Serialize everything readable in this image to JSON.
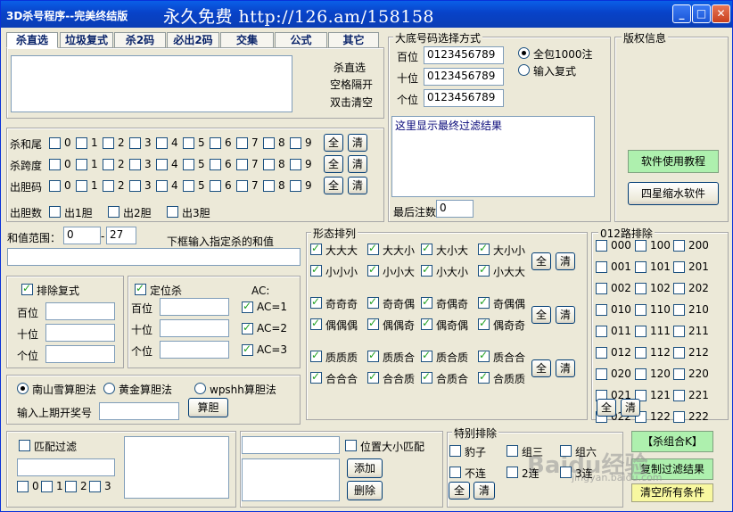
{
  "window": {
    "title": "3D杀号程序--完美终结版",
    "banner": "永久免费 http://126.am/158158"
  },
  "tabs": [
    "杀直选",
    "垃圾复式",
    "杀2码",
    "必出2码",
    "交集",
    "公式",
    "其它"
  ],
  "hint": [
    "杀直选",
    "空格隔开",
    "双击清空"
  ],
  "kill_rows": [
    {
      "label": "杀和尾",
      "digits": [
        "0",
        "1",
        "2",
        "3",
        "4",
        "5",
        "6",
        "7",
        "8",
        "9"
      ],
      "all": "全",
      "clear": "清"
    },
    {
      "label": "杀跨度",
      "digits": [
        "0",
        "1",
        "2",
        "3",
        "4",
        "5",
        "6",
        "7",
        "8",
        "9"
      ],
      "all": "全",
      "clear": "清"
    },
    {
      "label": "出胆码",
      "digits": [
        "0",
        "1",
        "2",
        "3",
        "4",
        "5",
        "6",
        "7",
        "8",
        "9"
      ],
      "all": "全",
      "clear": "清"
    }
  ],
  "dan_count": {
    "label": "出胆数",
    "options": [
      "出1胆",
      "出2胆",
      "出3胆"
    ]
  },
  "base": {
    "title": "大底号码选择方式",
    "rows": [
      {
        "label": "百位",
        "value": "0123456789"
      },
      {
        "label": "十位",
        "value": "0123456789"
      },
      {
        "label": "个位",
        "value": "0123456789"
      }
    ],
    "radio1": "全包1000注",
    "radio2": "输入复式",
    "result": "这里显示最终过滤结果",
    "count_label": "最后注数",
    "count_value": "0"
  },
  "copyright": {
    "title": "版权信息",
    "btn1": "软件使用教程",
    "btn2": "四星缩水软件"
  },
  "sum_range": {
    "label": "和值范围：",
    "from": "0",
    "to": "27",
    "hint": "下框输入指定杀的和值"
  },
  "exclude": {
    "label": "排除复式",
    "rows": [
      "百位",
      "十位",
      "个位"
    ]
  },
  "position": {
    "label": "定位杀",
    "ac_title": "AC:",
    "rows": [
      "百位",
      "十位",
      "个位"
    ],
    "ac": [
      "AC=1",
      "AC=2",
      "AC=3"
    ]
  },
  "method": {
    "options": [
      "南山雪算胆法",
      "黄金算胆法",
      "wpshh算胆法"
    ],
    "input_label": "输入上期开奖号",
    "calc": "算胆"
  },
  "shape": {
    "title": "形态排列",
    "row1": [
      "大大大",
      "大大小",
      "大小大",
      "大小小"
    ],
    "row2": [
      "小小小",
      "小小大",
      "小大小",
      "小大大"
    ],
    "row3": [
      "奇奇奇",
      "奇奇偶",
      "奇偶奇",
      "奇偶偶"
    ],
    "row4": [
      "偶偶偶",
      "偶偶奇",
      "偶奇偶",
      "偶奇奇"
    ],
    "row5": [
      "质质质",
      "质质合",
      "质合质",
      "质合合"
    ],
    "row6": [
      "合合合",
      "合合质",
      "合质合",
      "合质质"
    ],
    "all": "全",
    "clear": "清"
  },
  "road": {
    "title": "012路排除",
    "col1": [
      "000",
      "001",
      "002",
      "010",
      "011",
      "012",
      "020",
      "021",
      "022"
    ],
    "col2": [
      "100",
      "101",
      "102",
      "110",
      "111",
      "112",
      "120",
      "121",
      "122"
    ],
    "col3": [
      "200",
      "201",
      "202",
      "210",
      "211",
      "212",
      "220",
      "221",
      "222"
    ],
    "all": "全",
    "clear": "清"
  },
  "match": {
    "label": "匹配过滤",
    "digits": [
      "0",
      "1",
      "2",
      "3"
    ]
  },
  "pos_match": {
    "label": "位置大小匹配",
    "add": "添加",
    "del": "删除"
  },
  "special": {
    "title": "特别排除",
    "items": [
      "豹子",
      "组三",
      "组六",
      "不连",
      "2连",
      "3连"
    ],
    "all": "全",
    "clear": "清"
  },
  "actions": {
    "kill": "【杀组合K】",
    "copy": "复制过滤结果",
    "reset": "清空所有条件"
  },
  "watermark": {
    "text": "Baidu经验",
    "url": "jingyan.baidu.com"
  }
}
